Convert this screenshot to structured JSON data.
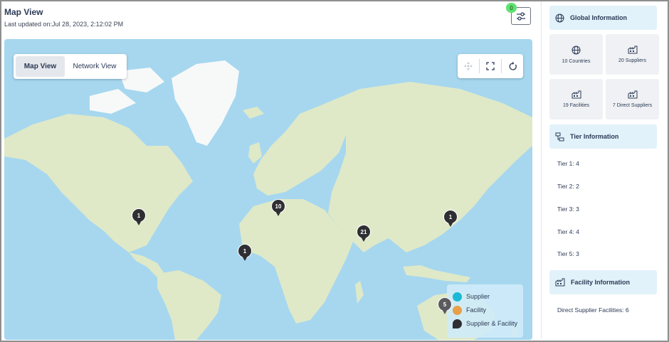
{
  "header": {
    "title": "Map View",
    "last_updated": "Last updated on:Jul 28, 2023, 2:12:02 PM",
    "filter_count": "0"
  },
  "map": {
    "view_toggle": {
      "map_view": "Map View",
      "network_view": "Network View",
      "active": "Map View"
    },
    "tools": [
      "move-icon",
      "fullscreen-icon",
      "refresh-icon"
    ],
    "clusters": [
      {
        "region": "North America",
        "count": "1"
      },
      {
        "region": "Europe",
        "count": "10"
      },
      {
        "region": "West Africa",
        "count": "1"
      },
      {
        "region": "India",
        "count": "21"
      },
      {
        "region": "Japan",
        "count": "1"
      },
      {
        "region": "Australia",
        "count": "5"
      }
    ],
    "legend": [
      {
        "label": "Supplier",
        "color": "#1bb9d6"
      },
      {
        "label": "Facility",
        "color": "#e7a04a"
      },
      {
        "label": "Supplier & Facility",
        "color": "#2f2f33"
      }
    ],
    "colors": {
      "ocean": "#a6d7ef",
      "land": "#dfe9c8",
      "ice": "#f7f9f9"
    }
  },
  "sidebar": {
    "global": {
      "title": "Global Information",
      "tiles": [
        {
          "label": "10 Countries",
          "icon": "globe-icon"
        },
        {
          "label": "20 Suppliers",
          "icon": "factory-icon"
        },
        {
          "label": "19 Facilities",
          "icon": "factory-icon"
        },
        {
          "label": "7 Direct Suppliers",
          "icon": "factory-icon"
        }
      ]
    },
    "tier": {
      "title": "Tier Information",
      "items": [
        "Tier 1: 4",
        "Tier 2: 2",
        "Tier 3: 3",
        "Tier 4: 4",
        "Tier 5: 3"
      ]
    },
    "facility": {
      "title": "Facility Information",
      "items": [
        "Direct Supplier Facilities: 6"
      ]
    }
  }
}
